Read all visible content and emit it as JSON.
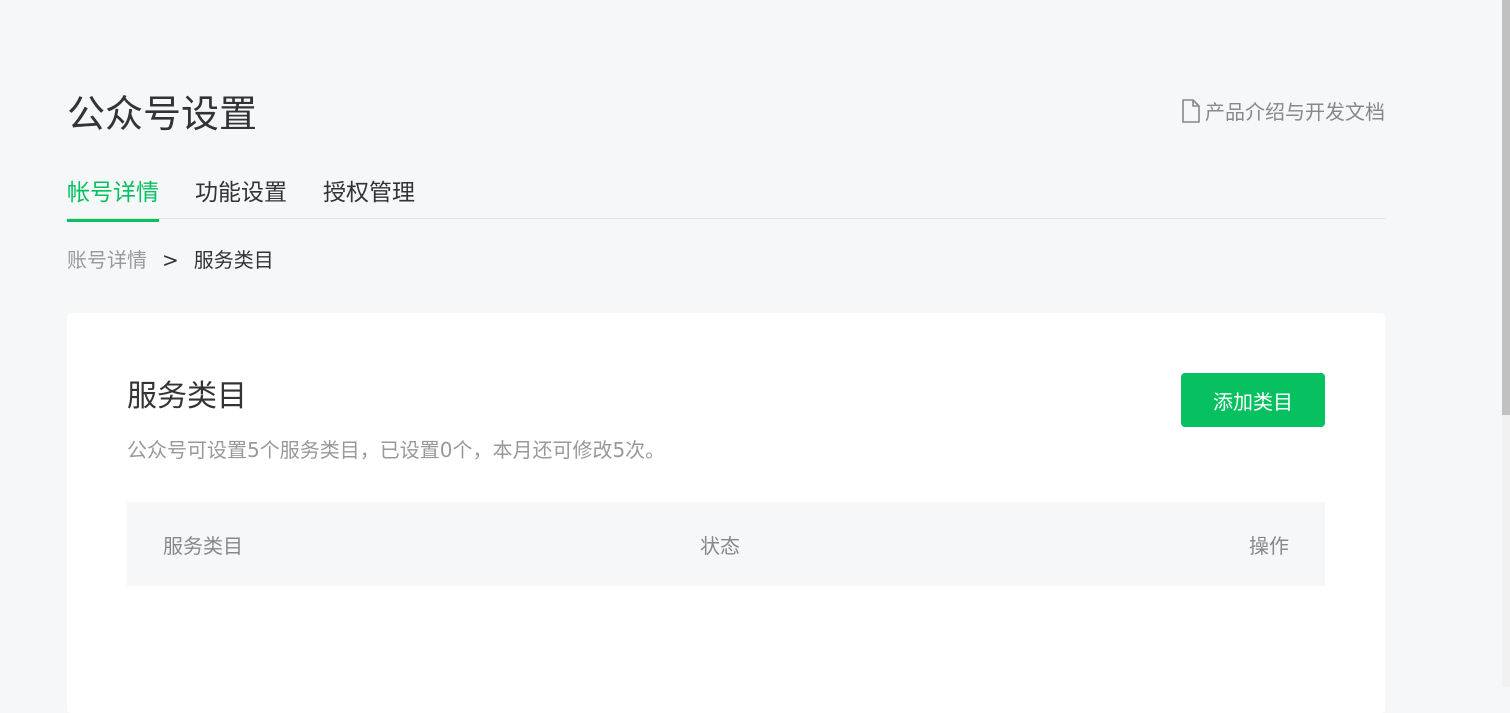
{
  "header": {
    "title": "公众号设置",
    "doc_link_label": "产品介绍与开发文档",
    "doc_icon": "document-icon"
  },
  "tabs": [
    {
      "label": "帐号详情",
      "active": true
    },
    {
      "label": "功能设置",
      "active": false
    },
    {
      "label": "授权管理",
      "active": false
    }
  ],
  "breadcrumb": {
    "parent": "账号详情",
    "separator": ">",
    "current": "服务类目"
  },
  "card": {
    "title": "服务类目",
    "description": "公众号可设置5个服务类目，已设置0个，本月还可修改5次。",
    "add_button_label": "添加类目",
    "table": {
      "columns": [
        "服务类目",
        "状态",
        "操作"
      ],
      "rows": []
    }
  },
  "colors": {
    "accent": "#07c160",
    "background": "#f6f7f9"
  }
}
